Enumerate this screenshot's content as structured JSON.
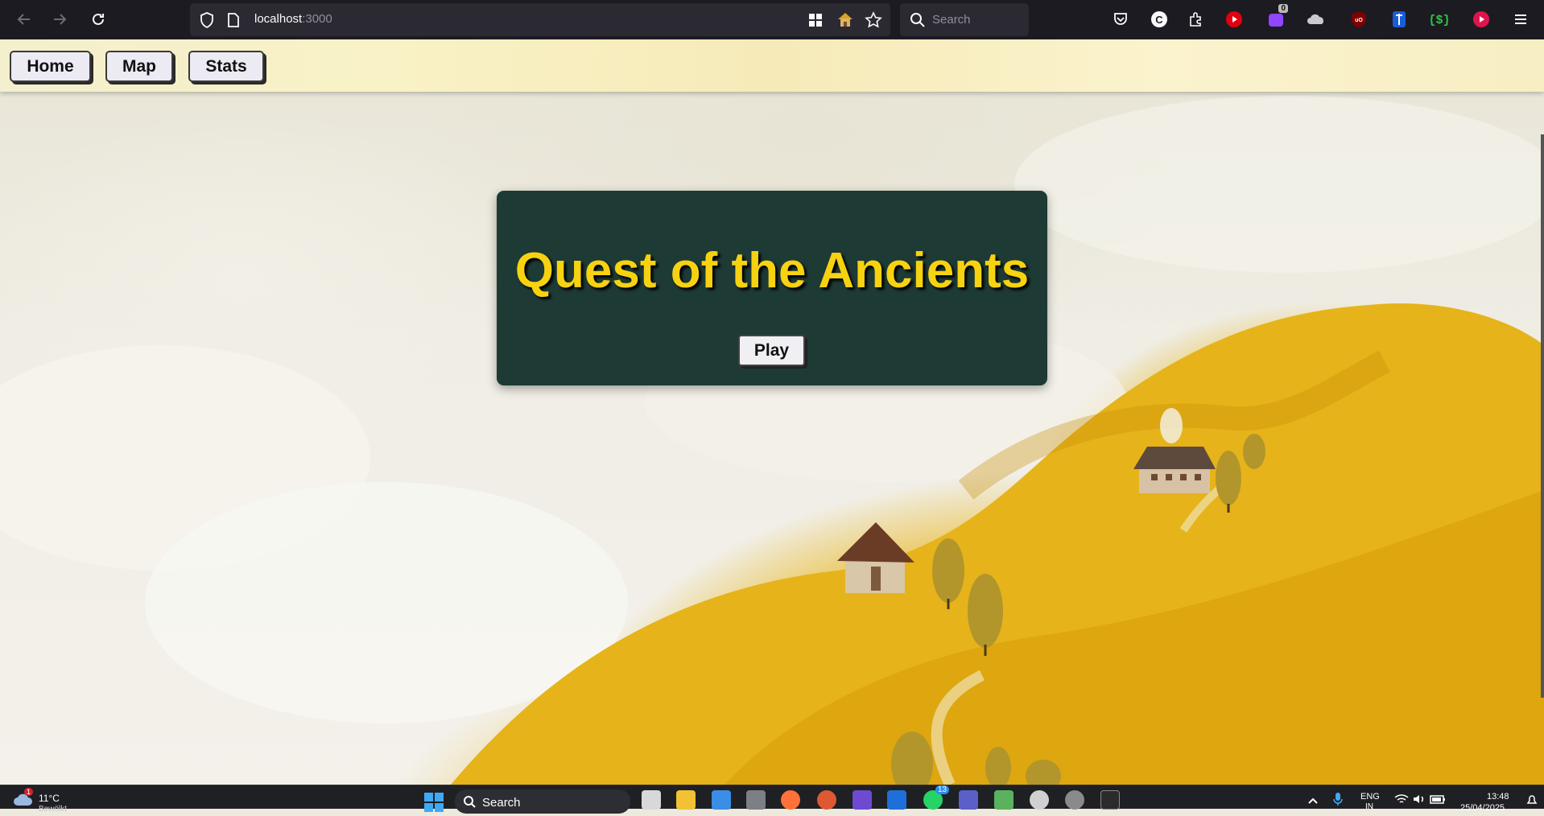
{
  "browser": {
    "url_host": "localhost",
    "url_port": ":3000",
    "search_placeholder": "Search",
    "extension_badge": "0"
  },
  "nav": {
    "links": [
      {
        "label": "Home"
      },
      {
        "label": "Map"
      },
      {
        "label": "Stats"
      }
    ]
  },
  "hero": {
    "title": "Quest of the Ancients",
    "play_label": "Play"
  },
  "taskbar": {
    "weather_temp": "11°C",
    "weather_badge": "1",
    "weather_desc": "Bewölkt",
    "search_label": "Search",
    "whatsapp_badge": "13",
    "lang": "ENG",
    "lang_sub": "IN",
    "time": "13:48",
    "date": "25/04/2025"
  }
}
